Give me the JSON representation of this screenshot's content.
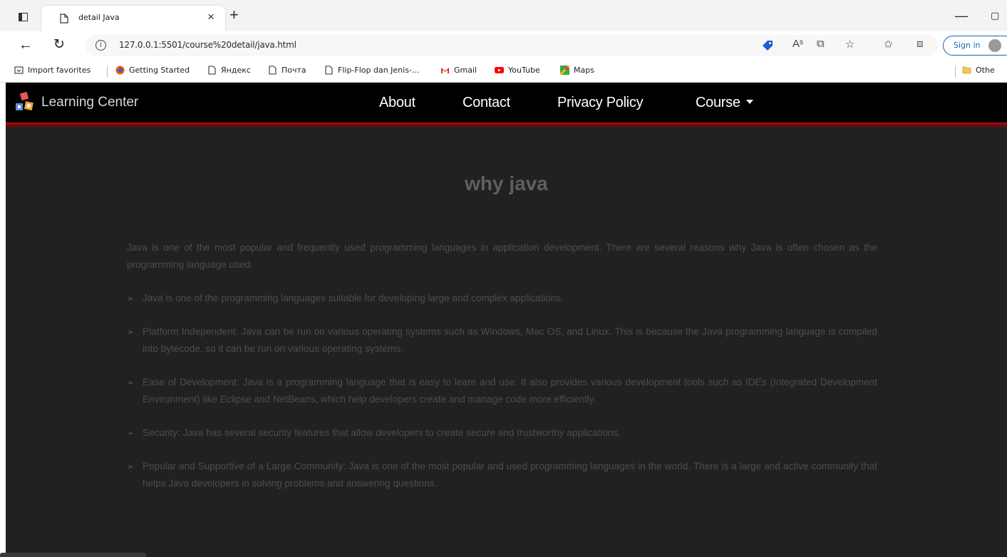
{
  "browser": {
    "tab_title": "detail Java",
    "url": "127.0.0.1:5501/course%20detail/java.html",
    "sign_in_label": "Sign in",
    "favorites": [
      {
        "label": "Import favorites",
        "icon": "import-icon"
      },
      {
        "label": "Getting Started",
        "icon": "firefox-icon"
      },
      {
        "label": "Яндекс",
        "icon": "page-icon"
      },
      {
        "label": "Почта",
        "icon": "page-icon"
      },
      {
        "label": "Flip-Flop dan Jenis-...",
        "icon": "page-icon"
      },
      {
        "label": "Gmail",
        "icon": "gmail-icon"
      },
      {
        "label": "YouTube",
        "icon": "youtube-icon"
      },
      {
        "label": "Maps",
        "icon": "maps-icon"
      }
    ],
    "other_favorites_label": "Othe"
  },
  "navbar": {
    "brand": "Learning Center",
    "links": [
      "About",
      "Contact",
      "Privacy Policy",
      "Course"
    ]
  },
  "content": {
    "title": "why java",
    "intro": "Java is one of the most popular and frequently used programming languages in application development. There are several reasons why Java is often chosen as the programming language used.",
    "bullet_symbol": "➢",
    "points": [
      "Java is one of the programming languages suitable for developing large and complex applications.",
      "Platform Independent: Java can be run on various operating systems such as Windows, Mac OS, and Linux. This is because the Java programming language is compiled into bytecode, so it can be run on various operating systems.",
      "Ease of Development: Java is a programming language that is easy to learn and use. It also provides various development tools such as IDEs (Integrated Development Environment) like Eclipse and NetBeans, which help developers create and manage code more efficiently.",
      "Security: Java has several security features that allow developers to create secure and trustworthy applications.",
      "Popular and Supportive of a Large Community: Java is one of the most popular and used programming languages in the world. There is a large and active community that helps Java developers in solving problems and answering questions."
    ]
  },
  "colors": {
    "page_background": "#212121",
    "navbar_background": "#000000",
    "navbar_accent": "#c10d0d",
    "title_text": "#5f5f5f",
    "body_text": "#4d4d4d"
  }
}
